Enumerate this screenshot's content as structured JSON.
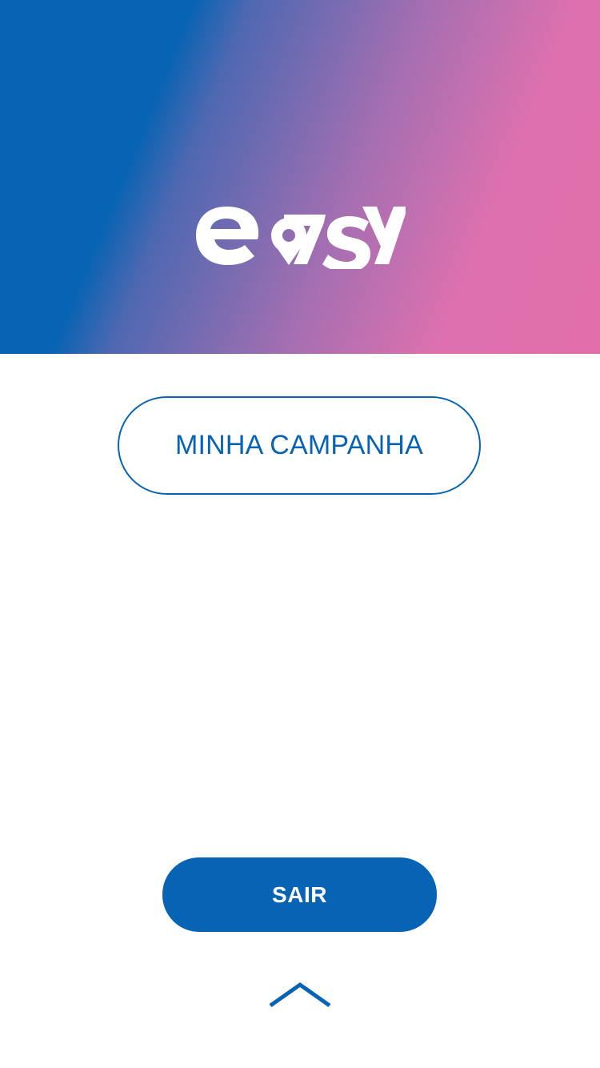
{
  "header": {
    "logo": "e7sy",
    "background_colors": [
      "#0763b3",
      "#e06fab"
    ]
  },
  "actions": {
    "campaign_label": "MINHA CAMPANHA",
    "logout_label": "SAIR"
  },
  "footer": {
    "icon": "chevron-up-icon"
  },
  "colors": {
    "accent": "#0763b3",
    "white": "#ffffff"
  }
}
